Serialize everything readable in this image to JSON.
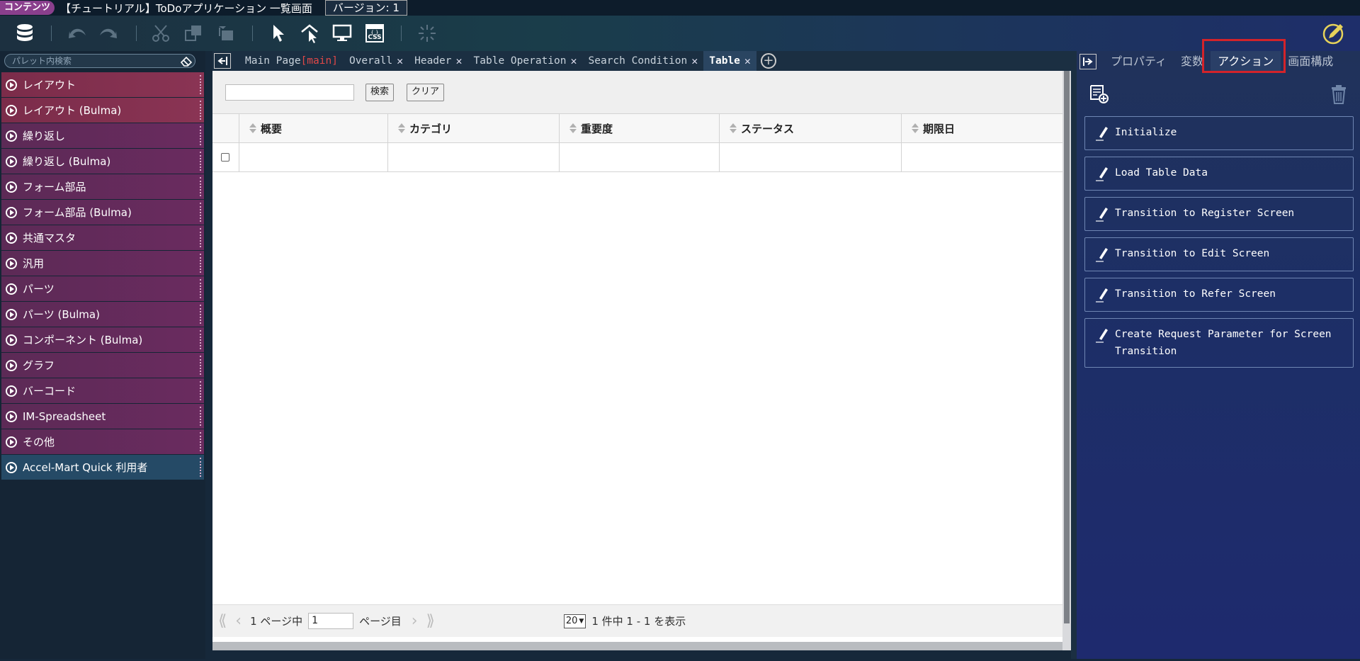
{
  "titlebar": {
    "contents_badge": "コンテンツ",
    "app_title": "【チュートリアル】ToDoアプリケーション 一覧画面",
    "version": "バージョン: 1"
  },
  "palette": {
    "search_placeholder": "パレット内検索",
    "items": [
      {
        "label": "レイアウト",
        "color": "red"
      },
      {
        "label": "レイアウト (Bulma)",
        "color": "red"
      },
      {
        "label": "繰り返し",
        "color": "purple"
      },
      {
        "label": "繰り返し (Bulma)",
        "color": "purple"
      },
      {
        "label": "フォーム部品",
        "color": "purple"
      },
      {
        "label": "フォーム部品 (Bulma)",
        "color": "purple"
      },
      {
        "label": "共通マスタ",
        "color": "purple"
      },
      {
        "label": "汎用",
        "color": "purple"
      },
      {
        "label": "パーツ",
        "color": "purple"
      },
      {
        "label": "パーツ (Bulma)",
        "color": "purple"
      },
      {
        "label": "コンポーネント (Bulma)",
        "color": "purple"
      },
      {
        "label": "グラフ",
        "color": "purple"
      },
      {
        "label": "バーコード",
        "color": "purple"
      },
      {
        "label": "IM-Spreadsheet",
        "color": "purple"
      },
      {
        "label": "その他",
        "color": "purple"
      },
      {
        "label": "Accel-Mart Quick 利用者",
        "color": "blue"
      }
    ]
  },
  "editor_tabs": {
    "main_page": "Main Page",
    "main_tag": "[main]",
    "tabs": [
      "Overall",
      "Header",
      "Table Operation",
      "Search Condition"
    ],
    "active": "Table"
  },
  "canvas": {
    "search_button": "検索",
    "clear_button": "クリア",
    "columns": [
      "概要",
      "カテゴリ",
      "重要度",
      "ステータス",
      "期限日"
    ],
    "pager": {
      "page_prefix": "1 ページ中",
      "page_value": "1",
      "page_suffix": "ページ目",
      "page_size": "20",
      "summary": "1 件中 1 - 1 を表示"
    }
  },
  "right_panel": {
    "tabs": [
      "プロパティ",
      "変数",
      "アクション",
      "画面構成"
    ],
    "active_tab": "アクション",
    "actions": [
      "Initialize",
      "Load Table Data",
      "Transition to Register Screen",
      "Transition to Edit Screen",
      "Transition to Refer Screen",
      "Create Request Parameter for Screen Transition"
    ]
  },
  "colors": {
    "highlight": "#d3232a",
    "palette_red": "#8a3454",
    "palette_purple": "#6a2b5f",
    "palette_blue": "#254a66"
  }
}
